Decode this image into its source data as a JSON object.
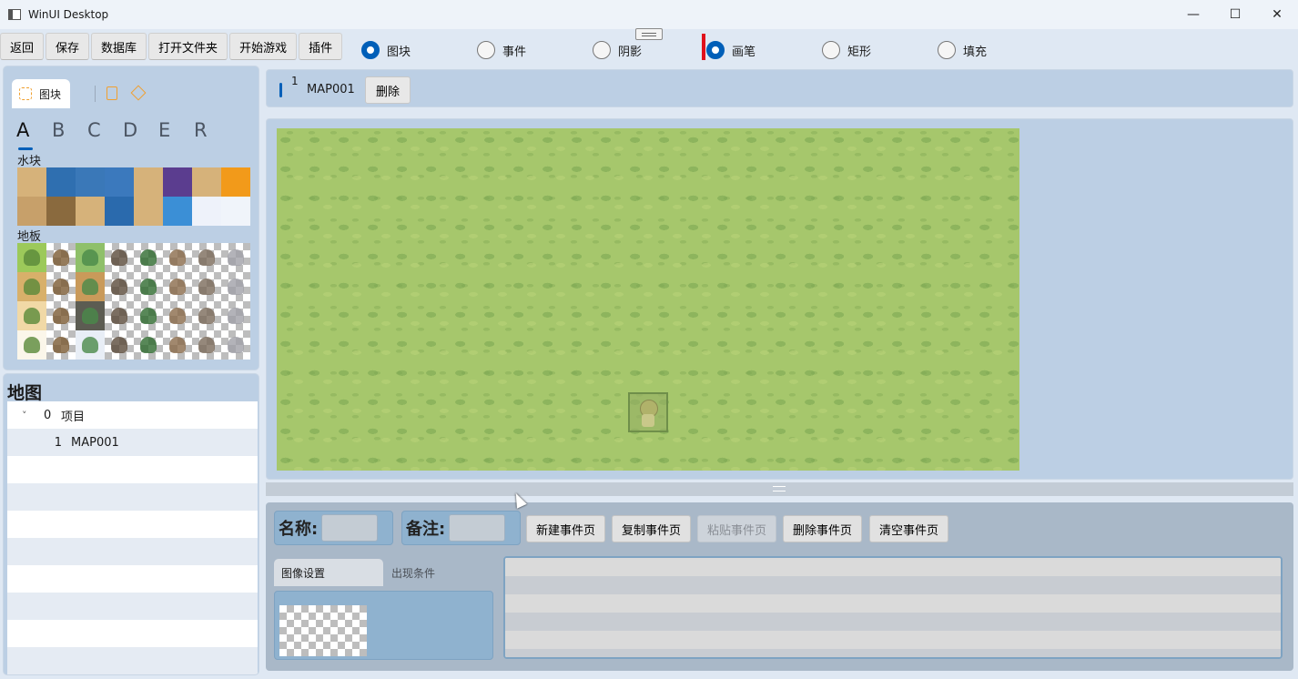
{
  "window": {
    "title": "WinUI Desktop",
    "minimize": "—",
    "maximize": "☐",
    "close": "✕"
  },
  "toolbar": {
    "buttons": [
      "返回",
      "保存",
      "数据库",
      "打开文件夹",
      "开始游戏",
      "插件"
    ]
  },
  "mode_radios": {
    "layer": [
      {
        "label": "图块",
        "selected": true
      },
      {
        "label": "事件",
        "selected": false
      },
      {
        "label": "阴影",
        "selected": false
      }
    ],
    "draw": [
      {
        "label": "画笔",
        "selected": true
      },
      {
        "label": "矩形",
        "selected": false
      },
      {
        "label": "填充",
        "selected": false
      }
    ]
  },
  "tile_panel": {
    "tab_label": "图块",
    "letters": [
      "A",
      "B",
      "C",
      "D",
      "E",
      "R"
    ],
    "active_letter": "A",
    "sections": [
      {
        "label": "水块",
        "rows": 2
      },
      {
        "label": "地板",
        "rows": 4
      }
    ]
  },
  "map_tree": {
    "header": "地图",
    "items": [
      {
        "expander": "˅",
        "id": "0",
        "name": "项目"
      },
      {
        "expander": "",
        "id": "1",
        "name": "MAP001"
      }
    ]
  },
  "open_map_tab": {
    "number": "1",
    "name": "MAP001",
    "delete_label": "删除"
  },
  "event_editor": {
    "name_label": "名称:",
    "name_value": "",
    "note_label": "备注:",
    "note_value": "",
    "buttons": [
      {
        "label": "新建事件页",
        "enabled": true
      },
      {
        "label": "复制事件页",
        "enabled": true
      },
      {
        "label": "粘贴事件页",
        "enabled": false
      },
      {
        "label": "删除事件页",
        "enabled": true
      },
      {
        "label": "清空事件页",
        "enabled": true
      }
    ],
    "tabs": [
      "图像设置",
      "出现条件"
    ]
  },
  "colors": {
    "accent": "#005fb8",
    "pen_indicator": "#e0101c",
    "panel": "#bccfe4",
    "grass": "#a6c76c"
  }
}
